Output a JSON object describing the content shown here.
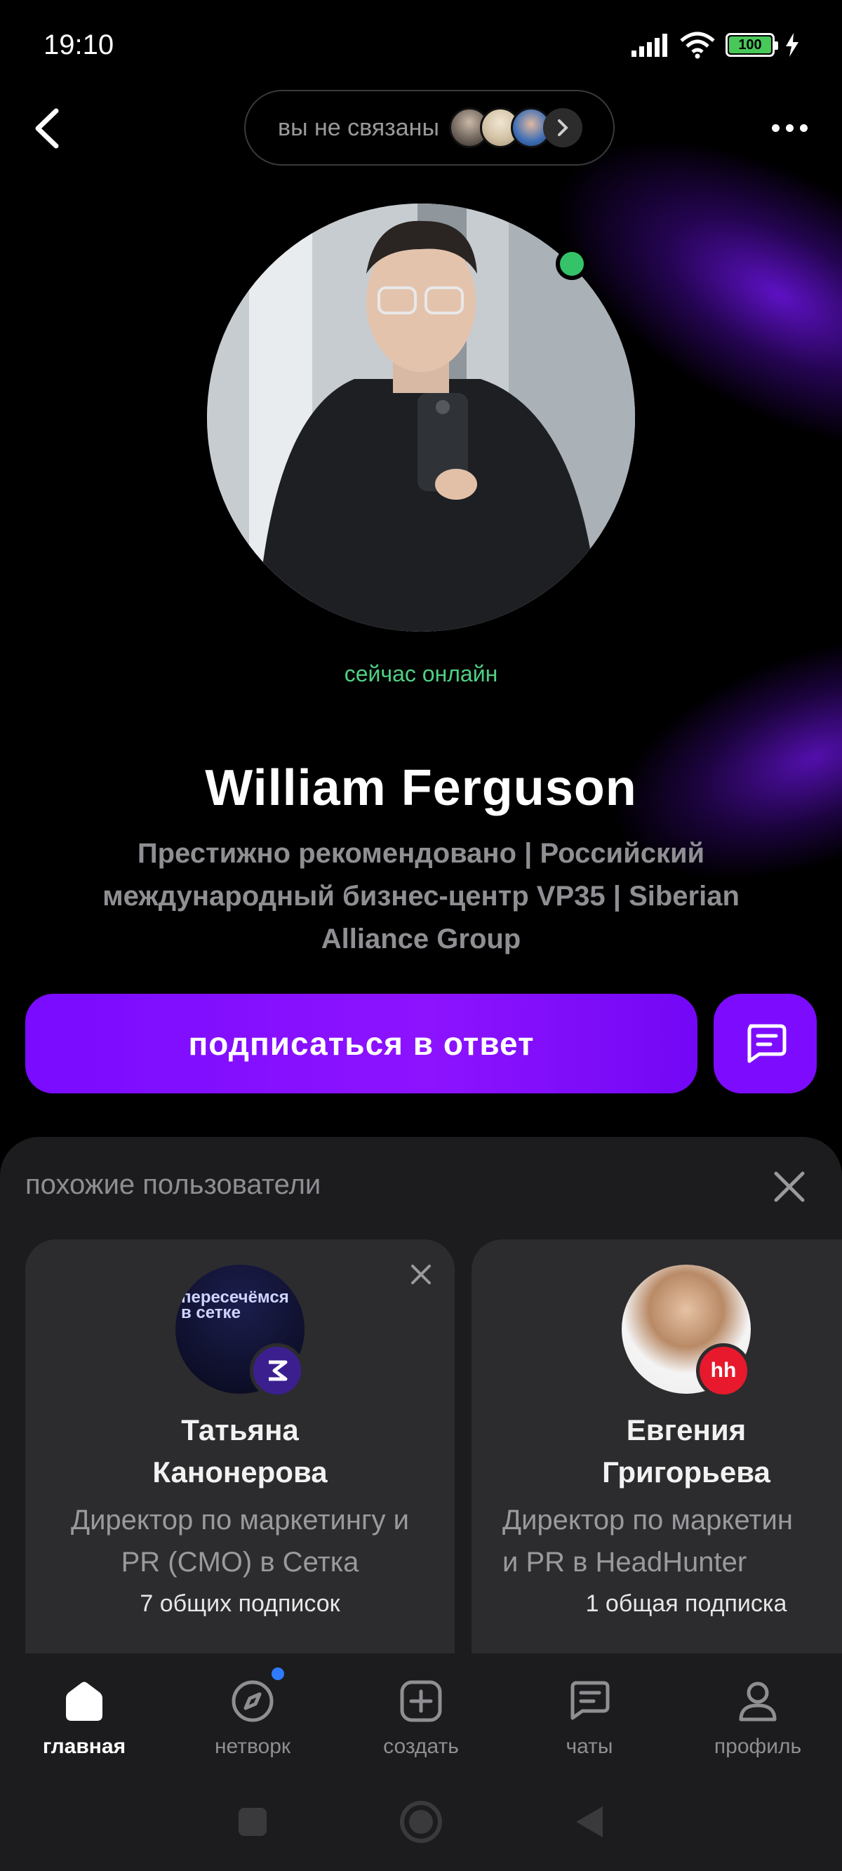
{
  "status_bar": {
    "time": "19:10",
    "battery": "100"
  },
  "header": {
    "connection_text": "вы не связаны"
  },
  "profile": {
    "online_text": "сейчас онлайн",
    "name": "William Ferguson",
    "bio": "Престижно рекомендовано | Российский международный бизнес-центр VP35 | Siberian Alliance Group",
    "subscribe_label": "подписаться в ответ"
  },
  "similar": {
    "title": "похожие пользователи",
    "cards": [
      {
        "name": "Татьяна Канонерова",
        "role": "Директор по маркетингу и PR (CMO) в Сетка",
        "common": "7 общих подписок",
        "avatar_text": "пересечёмся в сетке"
      },
      {
        "name": "Евгения Григорьева",
        "role": "Директор по маркетин\nи PR в HeadHunter",
        "common": "1 общая подписка",
        "badge": "hh"
      }
    ]
  },
  "nav": {
    "items": [
      {
        "label": "главная",
        "icon": "home-icon"
      },
      {
        "label": "нетворк",
        "icon": "compass-icon"
      },
      {
        "label": "создать",
        "icon": "plus-square-icon"
      },
      {
        "label": "чаты",
        "icon": "chat-icon"
      },
      {
        "label": "профиль",
        "icon": "user-icon"
      }
    ]
  },
  "colors": {
    "accent": "#7d0cff",
    "online": "#35c36a",
    "panel": "#1c1c1e",
    "card": "#2c2c2e"
  }
}
